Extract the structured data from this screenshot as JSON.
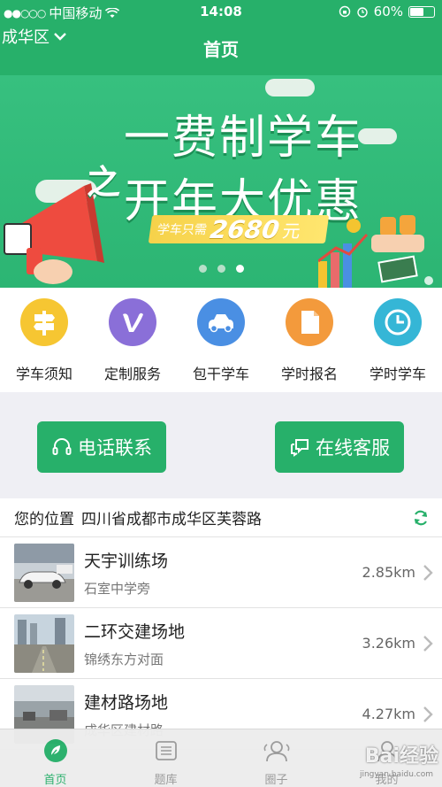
{
  "statusbar": {
    "signal_dots": "●●○○○",
    "carrier": "中国移动",
    "time": "14:08",
    "battery": "60%",
    "battery_fraction": 0.6
  },
  "navbar": {
    "city": "成华区",
    "title": "首页"
  },
  "banner": {
    "line1": "一费制学车",
    "connector": "之",
    "line2": "开年大优惠",
    "price_prefix": "学车只需",
    "price_amount": "2680",
    "price_unit": "元",
    "slides": 3,
    "active_slide": 3
  },
  "quick_menu": [
    {
      "label": "学车须知",
      "icon": "signpost-icon",
      "color": "#f6c632"
    },
    {
      "label": "定制服务",
      "icon": "v-logo-icon",
      "color": "#8a6fd8"
    },
    {
      "label": "包干学车",
      "icon": "car-icon",
      "color": "#4a8fe3"
    },
    {
      "label": "学时报名",
      "icon": "document-icon",
      "color": "#f39a3c"
    },
    {
      "label": "学时学车",
      "icon": "clock-icon",
      "color": "#35b6d6"
    }
  ],
  "contact": {
    "phone_label": "电话联系",
    "online_label": "在线客服",
    "accent": "#27b06a"
  },
  "location": {
    "label": "您的位置",
    "value": "四川省成都市成华区芙蓉路"
  },
  "sites": [
    {
      "name": "天宇训练场",
      "address": "石室中学旁",
      "distance": "2.85km"
    },
    {
      "name": "二环交建场地",
      "address": "锦绣东方对面",
      "distance": "3.26km"
    },
    {
      "name": "建材路场地",
      "address": "成华区建材路",
      "distance": "4.27km"
    }
  ],
  "tabs": [
    {
      "label": "首页",
      "icon": "home-leaf-icon",
      "active": true
    },
    {
      "label": "题库",
      "icon": "list-icon",
      "active": false
    },
    {
      "label": "圈子",
      "icon": "people-icon",
      "active": false
    },
    {
      "label": "我的",
      "icon": "profile-icon",
      "active": false
    }
  ],
  "watermark": {
    "text": "Bai经验",
    "sub": "jingyan.baidu.com"
  }
}
